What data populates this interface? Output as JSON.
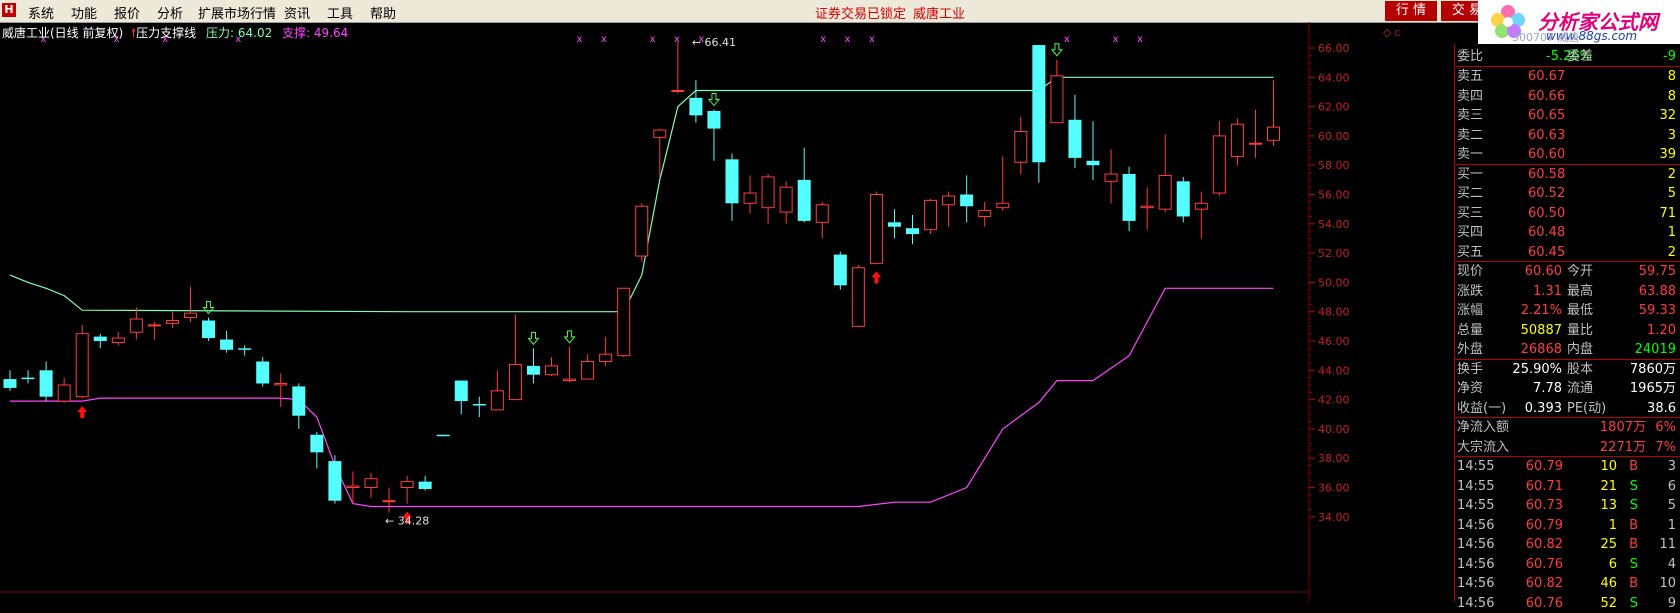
{
  "menu": {
    "logo": "H",
    "items": [
      "系统",
      "功能",
      "报价",
      "分析",
      "扩展市场行情",
      "资讯",
      "工具",
      "帮助"
    ],
    "lock_status": "证券交易已锁定",
    "stock_name": "威唐工业",
    "btn_quotes": "行 情",
    "btn_trade": "交 易"
  },
  "watermark": {
    "site_name": "分析家公式网",
    "url": "www.88gs.com",
    "faint_text": "300707 威唐"
  },
  "chart_header": {
    "title": "威唐工业(日线 前复权)",
    "indicator_name": "压力支撑线",
    "pressure": "压力: 64.02",
    "support": "支撑: 49.64"
  },
  "chart_data": {
    "type": "candlestick",
    "y_ticks": [
      "66.00",
      "64.00",
      "62.00",
      "60.00",
      "58.00",
      "56.00",
      "54.00",
      "52.00",
      "50.00",
      "48.00",
      "46.00",
      "44.00",
      "42.00",
      "40.00",
      "38.00",
      "36.00",
      "34.00"
    ],
    "annotations": {
      "high_label": "66.41",
      "low_label": "34.28"
    },
    "candles": [
      {
        "o": 43.4,
        "h": 44.0,
        "l": 42.6,
        "c": 42.8
      },
      {
        "o": 43.5,
        "h": 44.0,
        "l": 43.1,
        "c": 43.4
      },
      {
        "o": 44.0,
        "h": 44.6,
        "l": 41.9,
        "c": 42.2
      },
      {
        "o": 41.9,
        "h": 43.5,
        "l": 41.8,
        "c": 43.0
      },
      {
        "o": 42.2,
        "h": 47.1,
        "l": 42.1,
        "c": 46.5
      },
      {
        "o": 46.3,
        "h": 46.5,
        "l": 45.5,
        "c": 46.0
      },
      {
        "o": 45.9,
        "h": 46.6,
        "l": 45.7,
        "c": 46.2
      },
      {
        "o": 46.6,
        "h": 48.3,
        "l": 46.1,
        "c": 47.5
      },
      {
        "o": 47.1,
        "h": 47.3,
        "l": 46.1,
        "c": 47.1
      },
      {
        "o": 47.2,
        "h": 48.0,
        "l": 46.9,
        "c": 47.4
      },
      {
        "o": 47.6,
        "h": 49.7,
        "l": 47.3,
        "c": 47.9
      },
      {
        "o": 47.4,
        "h": 47.6,
        "l": 46.0,
        "c": 46.2
      },
      {
        "o": 46.1,
        "h": 46.7,
        "l": 45.2,
        "c": 45.4
      },
      {
        "o": 45.5,
        "h": 45.7,
        "l": 45.0,
        "c": 45.4
      },
      {
        "o": 44.6,
        "h": 44.9,
        "l": 42.9,
        "c": 43.1
      },
      {
        "o": 43.0,
        "h": 43.8,
        "l": 41.5,
        "c": 43.1
      },
      {
        "o": 42.9,
        "h": 43.1,
        "l": 40.0,
        "c": 40.9
      },
      {
        "o": 39.6,
        "h": 39.8,
        "l": 37.3,
        "c": 38.4
      },
      {
        "o": 37.8,
        "h": 38.2,
        "l": 34.9,
        "c": 35.1
      },
      {
        "o": 36.0,
        "h": 37.1,
        "l": 35.0,
        "c": 36.1
      },
      {
        "o": 36.0,
        "h": 37.0,
        "l": 35.3,
        "c": 36.6
      },
      {
        "o": 35.1,
        "h": 36.0,
        "l": 34.3,
        "c": 35.1
      },
      {
        "o": 36.0,
        "h": 36.8,
        "l": 34.9,
        "c": 36.4
      },
      {
        "o": 36.4,
        "h": 36.8,
        "l": 35.8,
        "c": 35.9
      },
      {
        "o": 39.6,
        "h": 39.6,
        "l": 39.5,
        "c": 39.5
      },
      {
        "o": 43.3,
        "h": 43.3,
        "l": 41.0,
        "c": 41.9
      },
      {
        "o": 41.7,
        "h": 42.2,
        "l": 40.8,
        "c": 41.6
      },
      {
        "o": 41.3,
        "h": 44.0,
        "l": 41.3,
        "c": 42.6
      },
      {
        "o": 42.0,
        "h": 47.8,
        "l": 42.0,
        "c": 44.4
      },
      {
        "o": 44.3,
        "h": 45.5,
        "l": 43.1,
        "c": 43.7
      },
      {
        "o": 43.7,
        "h": 44.9,
        "l": 43.6,
        "c": 44.3
      },
      {
        "o": 43.3,
        "h": 45.6,
        "l": 43.2,
        "c": 43.4
      },
      {
        "o": 43.4,
        "h": 45.1,
        "l": 43.4,
        "c": 44.6
      },
      {
        "o": 44.6,
        "h": 46.3,
        "l": 44.3,
        "c": 45.1
      },
      {
        "o": 45.0,
        "h": 49.6,
        "l": 44.9,
        "c": 49.6
      },
      {
        "o": 51.8,
        "h": 55.4,
        "l": 51.4,
        "c": 55.2
      },
      {
        "o": 59.9,
        "h": 60.5,
        "l": 57.2,
        "c": 60.4
      },
      {
        "o": 63.1,
        "h": 66.4,
        "l": 62.9,
        "c": 63.1
      },
      {
        "o": 62.6,
        "h": 63.8,
        "l": 60.9,
        "c": 61.4
      },
      {
        "o": 61.7,
        "h": 61.8,
        "l": 58.3,
        "c": 60.5
      },
      {
        "o": 58.4,
        "h": 58.8,
        "l": 54.2,
        "c": 55.4
      },
      {
        "o": 55.4,
        "h": 57.3,
        "l": 54.7,
        "c": 56.1
      },
      {
        "o": 55.1,
        "h": 57.4,
        "l": 54.0,
        "c": 57.2
      },
      {
        "o": 54.8,
        "h": 56.9,
        "l": 54.0,
        "c": 56.5
      },
      {
        "o": 57.0,
        "h": 59.2,
        "l": 54.1,
        "c": 54.2
      },
      {
        "o": 54.1,
        "h": 55.5,
        "l": 53.0,
        "c": 55.3
      },
      {
        "o": 51.9,
        "h": 52.1,
        "l": 49.5,
        "c": 49.8
      },
      {
        "o": 47.0,
        "h": 51.2,
        "l": 47.0,
        "c": 51.0
      },
      {
        "o": 51.3,
        "h": 56.2,
        "l": 51.3,
        "c": 56.0
      },
      {
        "o": 54.1,
        "h": 55.0,
        "l": 53.0,
        "c": 53.8
      },
      {
        "o": 53.7,
        "h": 54.6,
        "l": 52.6,
        "c": 53.3
      },
      {
        "o": 53.6,
        "h": 55.7,
        "l": 53.3,
        "c": 55.6
      },
      {
        "o": 55.3,
        "h": 56.2,
        "l": 53.8,
        "c": 55.9
      },
      {
        "o": 56.0,
        "h": 57.3,
        "l": 54.1,
        "c": 55.2
      },
      {
        "o": 54.5,
        "h": 55.5,
        "l": 53.8,
        "c": 54.9
      },
      {
        "o": 55.1,
        "h": 58.6,
        "l": 54.9,
        "c": 55.4
      },
      {
        "o": 58.2,
        "h": 61.3,
        "l": 57.4,
        "c": 60.3
      },
      {
        "o": 66.2,
        "h": 66.2,
        "l": 56.8,
        "c": 58.2
      },
      {
        "o": 60.9,
        "h": 65.2,
        "l": 60.9,
        "c": 64.1
      },
      {
        "o": 61.1,
        "h": 62.8,
        "l": 57.8,
        "c": 58.5
      },
      {
        "o": 58.3,
        "h": 61.0,
        "l": 57.0,
        "c": 58.0
      },
      {
        "o": 56.9,
        "h": 59.1,
        "l": 55.4,
        "c": 57.4
      },
      {
        "o": 57.4,
        "h": 57.9,
        "l": 53.5,
        "c": 54.2
      },
      {
        "o": 55.1,
        "h": 56.5,
        "l": 53.6,
        "c": 55.2
      },
      {
        "o": 55.0,
        "h": 60.1,
        "l": 54.8,
        "c": 57.3
      },
      {
        "o": 56.9,
        "h": 57.2,
        "l": 54.1,
        "c": 54.5
      },
      {
        "o": 55.0,
        "h": 56.2,
        "l": 53.0,
        "c": 55.4
      },
      {
        "o": 56.1,
        "h": 61.0,
        "l": 55.9,
        "c": 60.0
      },
      {
        "o": 58.6,
        "h": 61.2,
        "l": 58.0,
        "c": 60.8
      },
      {
        "o": 59.5,
        "h": 61.8,
        "l": 58.5,
        "c": 59.5
      },
      {
        "o": 59.7,
        "h": 63.8,
        "l": 59.3,
        "c": 60.6
      }
    ],
    "pressure_line": [
      {
        "i": 0,
        "v": 50.5
      },
      {
        "i": 1,
        "v": 50.0
      },
      {
        "i": 2,
        "v": 49.6
      },
      {
        "i": 3,
        "v": 49.1
      },
      {
        "i": 4,
        "v": 48.1
      },
      {
        "i": 22,
        "v": 48.0
      },
      {
        "i": 34,
        "v": 48.0
      },
      {
        "i": 35,
        "v": 50.5
      },
      {
        "i": 36,
        "v": 57.0
      },
      {
        "i": 37,
        "v": 62.0
      },
      {
        "i": 38,
        "v": 63.1
      },
      {
        "i": 57,
        "v": 63.1
      },
      {
        "i": 58,
        "v": 64.0
      },
      {
        "i": 70,
        "v": 64.0
      }
    ],
    "support_line": [
      {
        "i": 0,
        "v": 41.9
      },
      {
        "i": 4,
        "v": 41.9
      },
      {
        "i": 5,
        "v": 42.1
      },
      {
        "i": 15,
        "v": 42.1
      },
      {
        "i": 16,
        "v": 42.0
      },
      {
        "i": 17,
        "v": 40.8
      },
      {
        "i": 18,
        "v": 37.5
      },
      {
        "i": 19,
        "v": 34.9
      },
      {
        "i": 20,
        "v": 34.7
      },
      {
        "i": 47,
        "v": 34.7
      },
      {
        "i": 49,
        "v": 35.0
      },
      {
        "i": 51,
        "v": 35.0
      },
      {
        "i": 53,
        "v": 36.0
      },
      {
        "i": 55,
        "v": 40.0
      },
      {
        "i": 57,
        "v": 41.8
      },
      {
        "i": 58,
        "v": 43.3
      },
      {
        "i": 60,
        "v": 43.3
      },
      {
        "i": 62,
        "v": 45.0
      },
      {
        "i": 64,
        "v": 49.6
      },
      {
        "i": 70,
        "v": 49.6
      }
    ],
    "sell_markers": [
      1,
      4,
      6,
      9,
      23,
      24,
      26,
      27,
      28,
      33,
      34,
      35,
      43,
      45,
      46
    ],
    "buy_up_arrows": [
      4,
      22,
      48
    ],
    "green_down_arrows": [
      11,
      29,
      31,
      39,
      58
    ],
    "colors": {
      "up": "#ff3c3c",
      "down": "#54ffff",
      "pressure": "#7fffb0",
      "support": "#ff44ff",
      "grid": "#800000"
    }
  },
  "panel": {
    "weibi": {
      "label": "委比",
      "value": "-5.26%",
      "label2": "委差",
      "value2": "-9"
    },
    "asks": [
      {
        "label": "卖五",
        "price": "60.67",
        "vol": "8"
      },
      {
        "label": "卖四",
        "price": "60.66",
        "vol": "8"
      },
      {
        "label": "卖三",
        "price": "60.65",
        "vol": "32"
      },
      {
        "label": "卖二",
        "price": "60.63",
        "vol": "3"
      },
      {
        "label": "卖一",
        "price": "60.60",
        "vol": "39"
      }
    ],
    "bids": [
      {
        "label": "买一",
        "price": "60.58",
        "vol": "2"
      },
      {
        "label": "买二",
        "price": "60.52",
        "vol": "5"
      },
      {
        "label": "买三",
        "price": "60.50",
        "vol": "71"
      },
      {
        "label": "买四",
        "price": "60.48",
        "vol": "1"
      },
      {
        "label": "买五",
        "price": "60.45",
        "vol": "2"
      }
    ],
    "quote": [
      {
        "l1": "现价",
        "v1": "60.60",
        "c1": "#ff3c3c",
        "l2": "今开",
        "v2": "59.75",
        "c2": "#ff3c3c"
      },
      {
        "l1": "涨跌",
        "v1": "1.31",
        "c1": "#ff3c3c",
        "l2": "最高",
        "v2": "63.88",
        "c2": "#ff3c3c"
      },
      {
        "l1": "涨幅",
        "v1": "2.21%",
        "c1": "#ff3c3c",
        "l2": "最低",
        "v2": "59.33",
        "c2": "#ff3c3c"
      },
      {
        "l1": "总量",
        "v1": "50887",
        "c1": "#ffff00",
        "l2": "量比",
        "v2": "1.20",
        "c2": "#ff3c3c"
      },
      {
        "l1": "外盘",
        "v1": "26868",
        "c1": "#ff3c3c",
        "l2": "内盘",
        "v2": "24019",
        "c2": "#00ff00"
      }
    ],
    "stats": [
      {
        "l1": "换手",
        "v1": "25.90%",
        "l2": "股本",
        "v2": "7860万"
      },
      {
        "l1": "净资",
        "v1": "7.78",
        "l2": "流通",
        "v2": "1965万"
      },
      {
        "l1": "收益(一)",
        "v1": "0.393",
        "l2": "PE(动)",
        "v2": "38.6"
      }
    ],
    "flows": [
      {
        "label": "净流入额",
        "amount": "1807万",
        "pct": "6%"
      },
      {
        "label": "大宗流入",
        "amount": "2271万",
        "pct": "7%"
      }
    ],
    "ticks": [
      {
        "time": "14:55",
        "price": "60.79",
        "vol": "10",
        "side": "B",
        "n": "3"
      },
      {
        "time": "14:55",
        "price": "60.71",
        "vol": "21",
        "side": "S",
        "n": "6"
      },
      {
        "time": "14:55",
        "price": "60.73",
        "vol": "13",
        "side": "S",
        "n": "5"
      },
      {
        "time": "14:56",
        "price": "60.79",
        "vol": "1",
        "side": "B",
        "n": "1"
      },
      {
        "time": "14:56",
        "price": "60.82",
        "vol": "25",
        "side": "B",
        "n": "11"
      },
      {
        "time": "14:56",
        "price": "60.76",
        "vol": "6",
        "side": "S",
        "n": "4"
      },
      {
        "time": "14:56",
        "price": "60.82",
        "vol": "46",
        "side": "B",
        "n": "10"
      },
      {
        "time": "14:56",
        "price": "60.76",
        "vol": "52",
        "side": "S",
        "n": "9"
      }
    ]
  }
}
